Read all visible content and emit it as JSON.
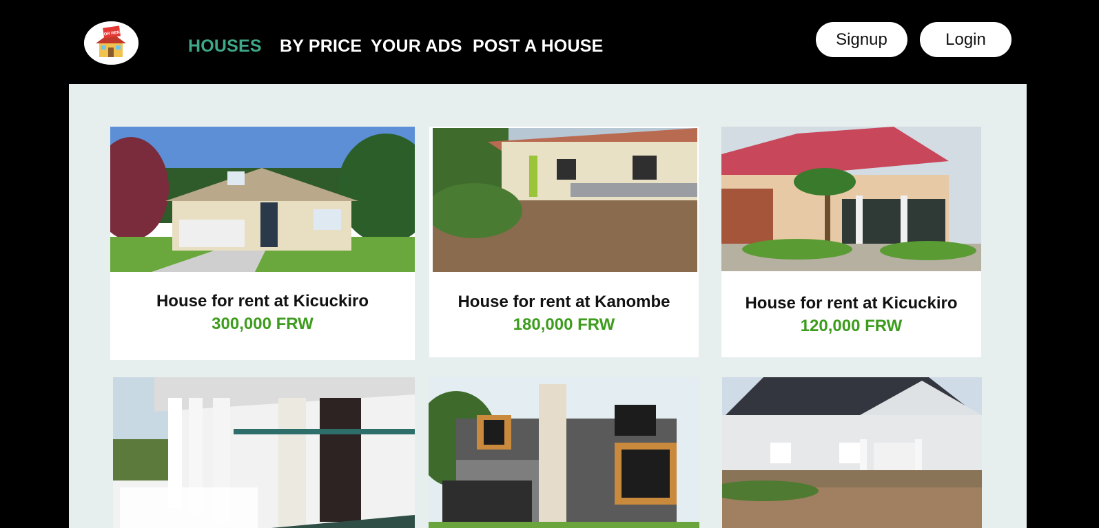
{
  "header": {
    "logo_text": "FOR RENT",
    "nav": [
      {
        "label": "HOUSES",
        "active": true
      },
      {
        "label": "BY PRICE",
        "active": false
      },
      {
        "label": "YOUR ADS",
        "active": false
      },
      {
        "label": "POST A HOUSE",
        "active": false
      }
    ],
    "signup_label": "Signup",
    "login_label": "Login"
  },
  "listings": [
    {
      "title": "House for rent at Kicuckiro",
      "price": "300,000 FRW"
    },
    {
      "title": "House for rent at Kanombe",
      "price": "180,000 FRW"
    },
    {
      "title": "House for rent at Kicuckiro",
      "price": "120,000 FRW"
    },
    {
      "title": "",
      "price": ""
    },
    {
      "title": "",
      "price": ""
    },
    {
      "title": "",
      "price": ""
    }
  ],
  "colors": {
    "background": "#000000",
    "nav_active": "#3fa888",
    "panel": "#e7eeee",
    "price": "#3d9c1d"
  }
}
